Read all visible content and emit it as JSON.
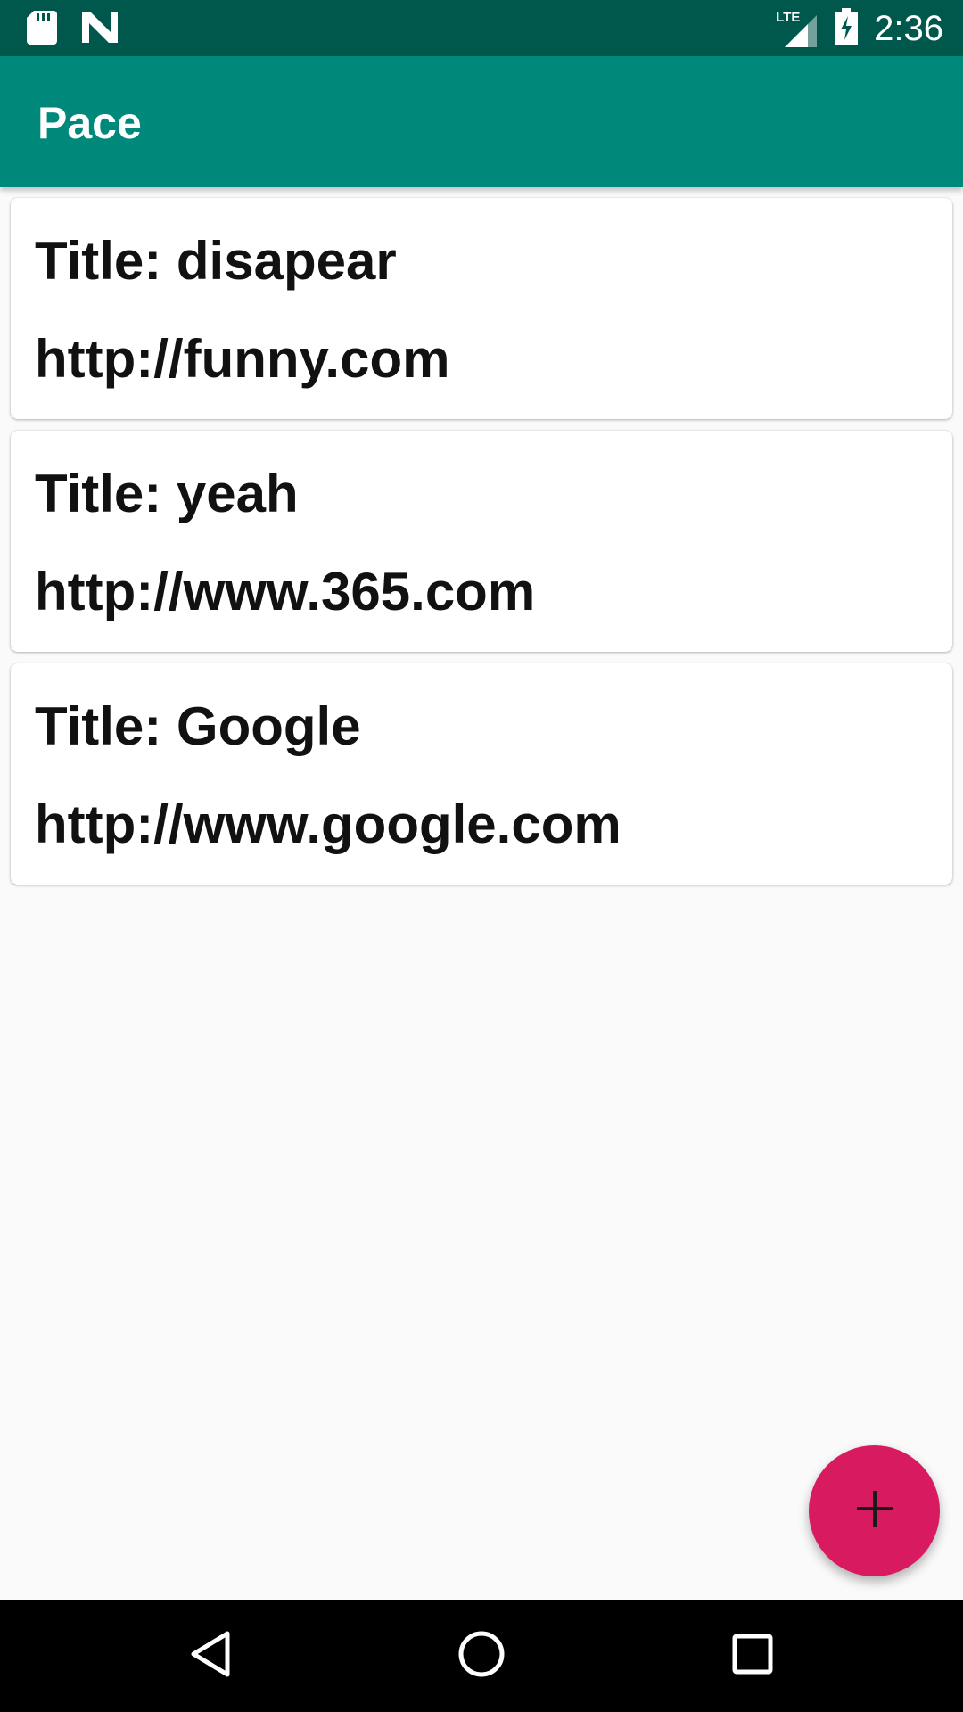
{
  "status_bar": {
    "time": "2:36",
    "network": "LTE",
    "icons": [
      "sd-card-icon",
      "n-logo-icon",
      "lte-signal-icon",
      "battery-charging-icon"
    ]
  },
  "app_bar": {
    "title": "Pace",
    "color": "#00897b"
  },
  "items": [
    {
      "title": "Title: disapear",
      "url": "http://funny.com"
    },
    {
      "title": "Title: yeah",
      "url": "http://www.365.com"
    },
    {
      "title": "Title: Google",
      "url": "http://www.google.com"
    }
  ],
  "fab": {
    "icon": "plus-icon",
    "color": "#d81b60"
  },
  "nav_bar": {
    "icons": [
      "back-icon",
      "home-icon",
      "recents-icon"
    ]
  }
}
